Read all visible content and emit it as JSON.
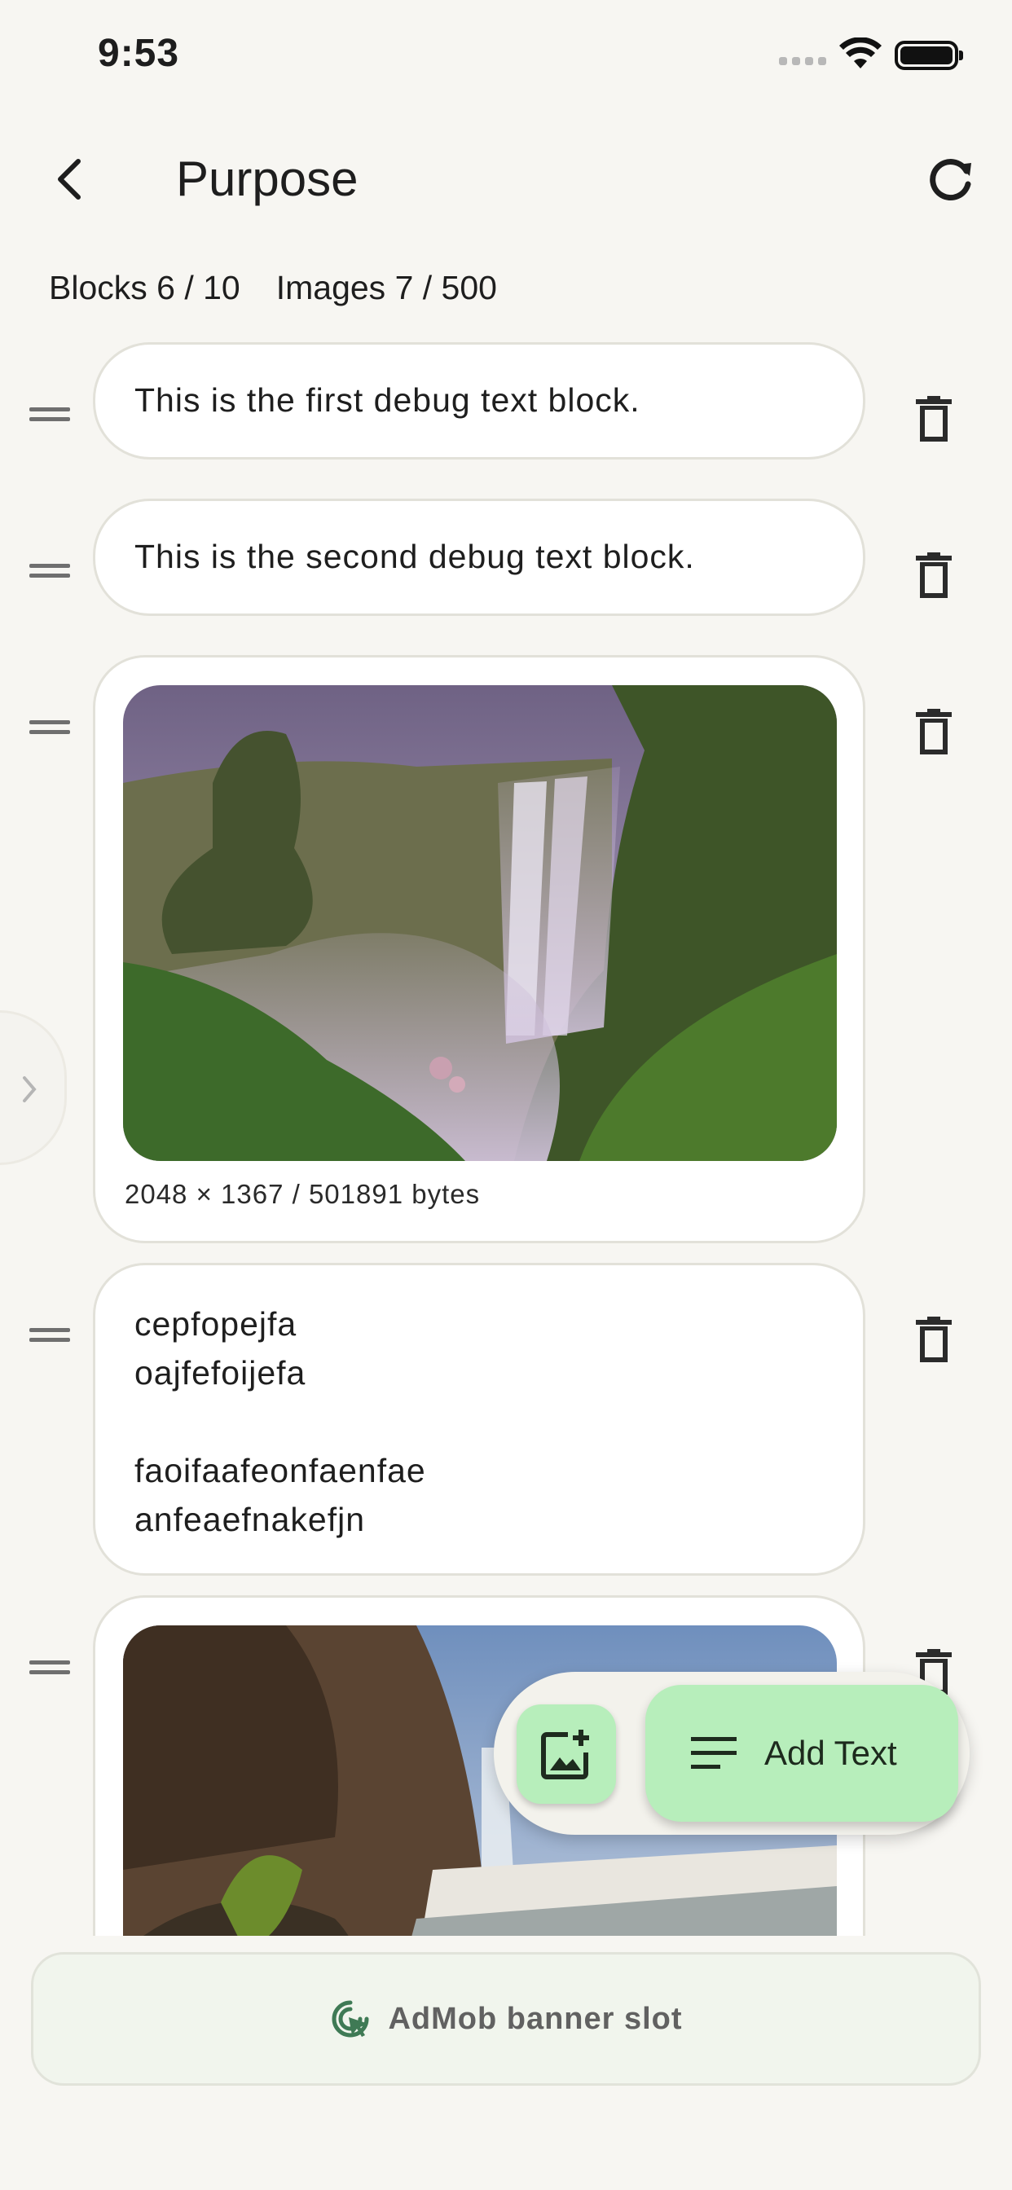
{
  "status_bar": {
    "time": "9:53"
  },
  "header": {
    "title": "Purpose"
  },
  "counts": {
    "blocks": "Blocks 6 / 10",
    "images": "Images 7 / 500"
  },
  "blocks": [
    {
      "type": "text",
      "text": "This is the first debug text block."
    },
    {
      "type": "text",
      "text": "This is the second debug text block."
    },
    {
      "type": "image",
      "caption": "2048 × 1367 / 501891 bytes"
    },
    {
      "type": "text",
      "text": "cepfopejfa\noajfefoijefa\n\nfaoifaafeonfaenfae\nanfeaefnakefjn"
    },
    {
      "type": "image"
    }
  ],
  "fab": {
    "add_text_label": "Add Text"
  },
  "ad": {
    "label": "AdMob banner slot"
  },
  "icons": {
    "back": "chevron-left-icon",
    "refresh": "refresh-icon",
    "drag": "drag-handle-icon",
    "delete": "trash-icon",
    "add_image": "add-image-icon",
    "add_text": "text-lines-icon",
    "ad": "ad-cursor-icon"
  },
  "colors": {
    "background": "#f7f6f2",
    "fab": "#b7eebb",
    "card_border": "#e2e1d9",
    "ad_icon": "#3f7a55"
  }
}
